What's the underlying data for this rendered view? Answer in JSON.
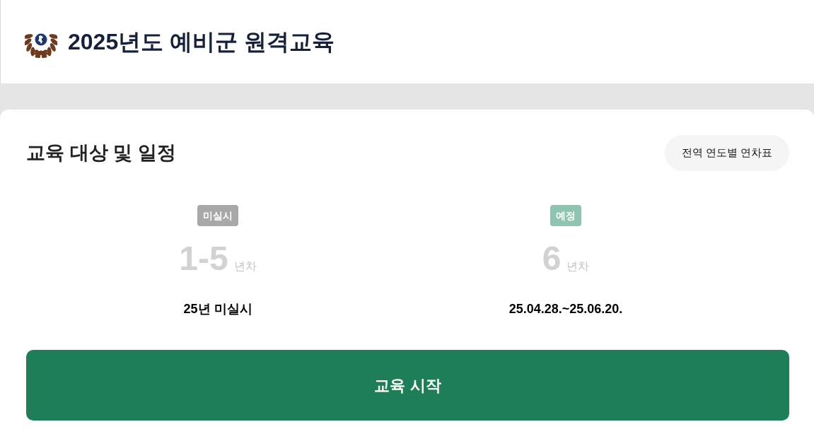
{
  "header": {
    "title": "2025년도 예비군 원격교육"
  },
  "schedule": {
    "title": "교육 대상 및 일정",
    "chart_button": "전역 연도별 연차표",
    "groups": [
      {
        "status": "미실시",
        "color": "#a8a8a8",
        "years": "1-5",
        "unit": "년차",
        "period": "25년 미실시"
      },
      {
        "status": "예정",
        "color": "#8fc4b0",
        "years": "6",
        "unit": "년차",
        "period": "25.04.28.~25.06.20."
      }
    ],
    "start_button": "교육 시작"
  }
}
